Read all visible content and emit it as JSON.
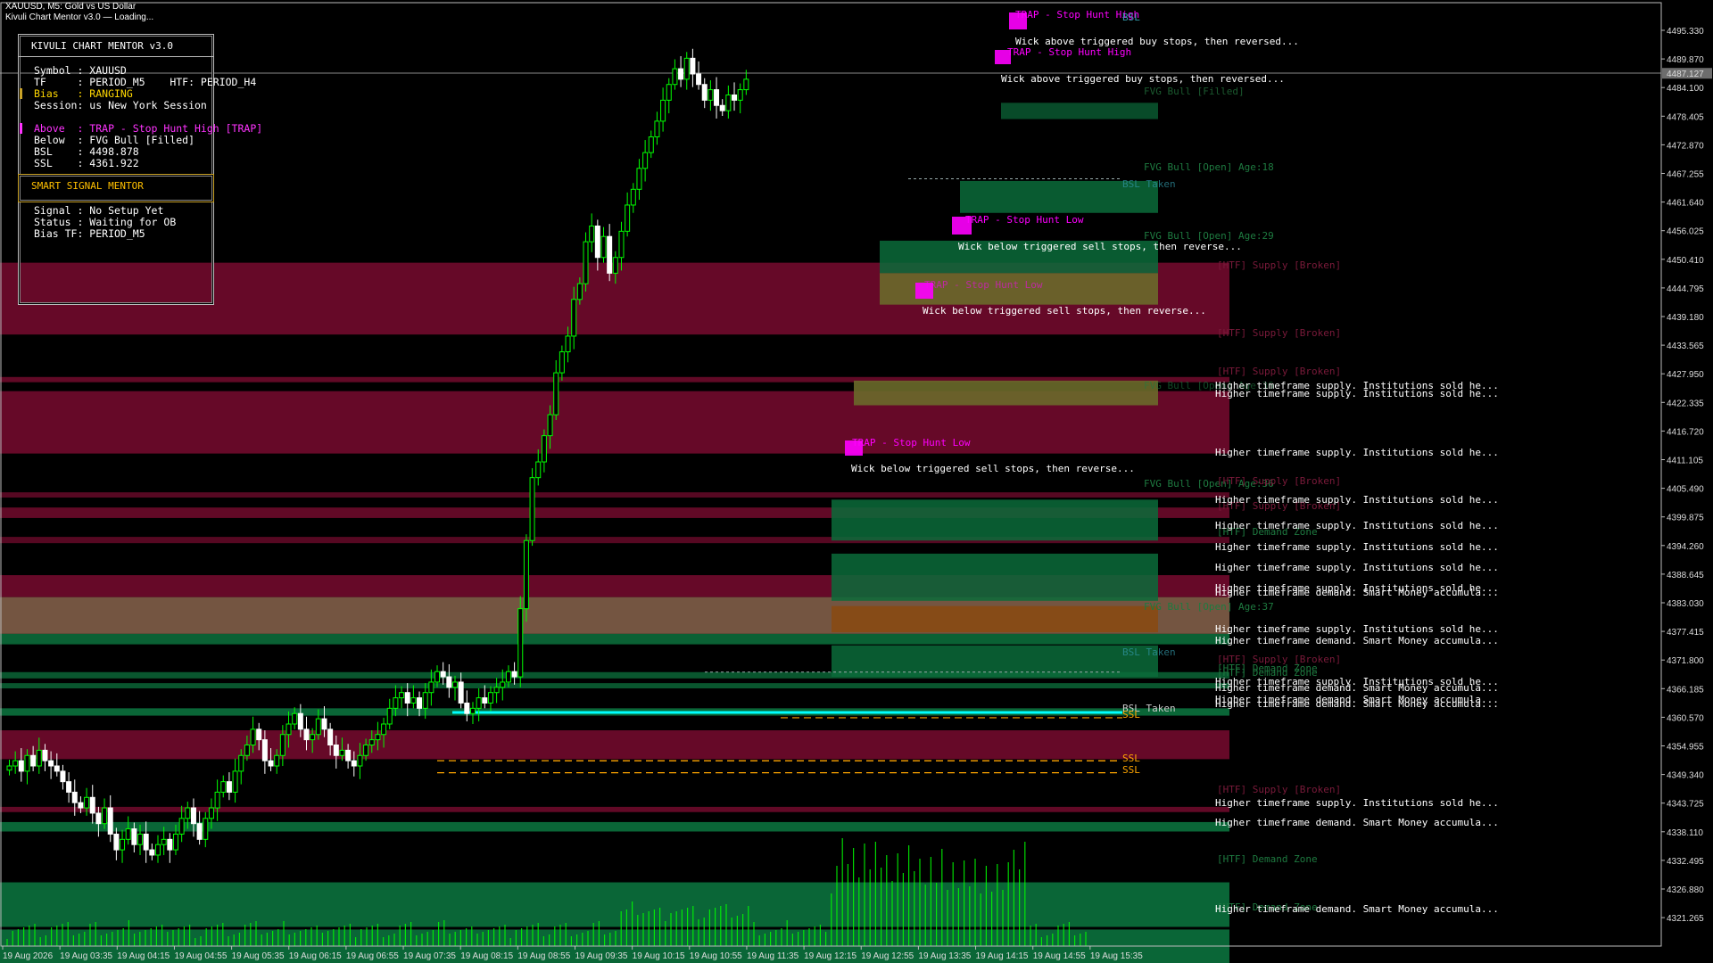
{
  "window": {
    "title": "XAUUSD, M5:  Gold vs US Dollar",
    "status": "Kivuli Chart Mentor v3.0 — Loading..."
  },
  "panel_mentor": {
    "title": "KIVULI CHART MENTOR  v3.0",
    "rows": [
      {
        "key": "Symbol ",
        "value": "XAUUSD",
        "color": "#ffffff"
      },
      {
        "key": "TF     ",
        "value": "PERIOD_M5    HTF: PERIOD_H4",
        "color": "#ffffff"
      },
      {
        "key": "Bias   ",
        "value": "RANGING",
        "color": "#ffd700"
      },
      {
        "key": "Session",
        "value": "us New York Session",
        "color": "#ffffff"
      },
      {
        "key": "",
        "value": "",
        "color": "#ffffff"
      },
      {
        "key": "Above  ",
        "value": "TRAP - Stop Hunt High [TRAP]",
        "color": "#ff33ff"
      },
      {
        "key": "Below  ",
        "value": "FVG Bull [Filled]",
        "color": "#ffffff"
      },
      {
        "key": "BSL    ",
        "value": "4498.878",
        "color": "#ffffff"
      },
      {
        "key": "SSL    ",
        "value": "4361.922",
        "color": "#ffffff"
      }
    ]
  },
  "panel_signal": {
    "title": "SMART SIGNAL MENTOR",
    "rows": [
      {
        "key": "Signal ",
        "value": "No Setup Yet"
      },
      {
        "key": "Status ",
        "value": "Waiting for OB"
      },
      {
        "key": "Bias TF",
        "value": "PERIOD_M5"
      }
    ]
  },
  "price_axis": {
    "labels": [
      "4495.330",
      "4489.870",
      "4484.100",
      "4478.405",
      "4472.870",
      "4467.255",
      "4461.640",
      "4456.025",
      "4450.410",
      "4444.795",
      "4439.180",
      "4433.565",
      "4427.950",
      "4422.335",
      "4416.720",
      "4411.105",
      "4405.490",
      "4399.875",
      "4394.260",
      "4388.645",
      "4383.030",
      "4377.415",
      "4371.800",
      "4366.185",
      "4360.570",
      "4354.955",
      "4349.340",
      "4343.725",
      "4338.110",
      "4332.495",
      "4326.880",
      "4321.265"
    ],
    "current": "4487.127"
  },
  "time_axis": {
    "labels": [
      "19 Aug 2026",
      "19 Aug 03:35",
      "19 Aug 04:15",
      "19 Aug 04:55",
      "19 Aug 05:35",
      "19 Aug 06:15",
      "19 Aug 06:55",
      "19 Aug 07:35",
      "19 Aug 08:15",
      "19 Aug 08:55",
      "19 Aug 09:35",
      "19 Aug 10:15",
      "19 Aug 10:55",
      "19 Aug 11:35",
      "19 Aug 12:15",
      "19 Aug 12:55",
      "19 Aug 13:35",
      "19 Aug 14:15",
      "19 Aug 14:55",
      "19 Aug 15:35"
    ]
  },
  "chart_labels": {
    "trap_high": "TRAP - Stop Hunt High",
    "trap_low": "TRAP - Stop Hunt Low",
    "wick_above": "Wick above triggered buy stops, then reversed...",
    "wick_below": "Wick below triggered sell stops, then reverse...",
    "bsl": "BSL",
    "bsl_taken": "BSL Taken",
    "ssl": "SSL",
    "fvg_filled": "FVG Bull [Filled]",
    "fvg_open_18": "FVG Bull [Open] Age:18",
    "fvg_open_29": "FVG Bull [Open] Age:29",
    "fvg_open_36": "FVG Bull [Open] Age:36",
    "fvg_open_37": "FVG Bull [Open] Age:37",
    "htf_supply_broken": "[HTF] Supply [Broken]",
    "htf_demand": "[HTF] Demand Zone",
    "supply_note": "Higher timeframe supply. Institutions sold he...",
    "demand_note": "Higher timeframe demand. Smart Money accumula..."
  },
  "colors": {
    "bull": "#00ff00",
    "bear": "#ffffff",
    "supply": "#6b0a2a",
    "demand": "#0b6b3a",
    "trap": "#ff00ff",
    "bsl_ssl": "#ffa500",
    "line_cyan": "#00ffff"
  }
}
